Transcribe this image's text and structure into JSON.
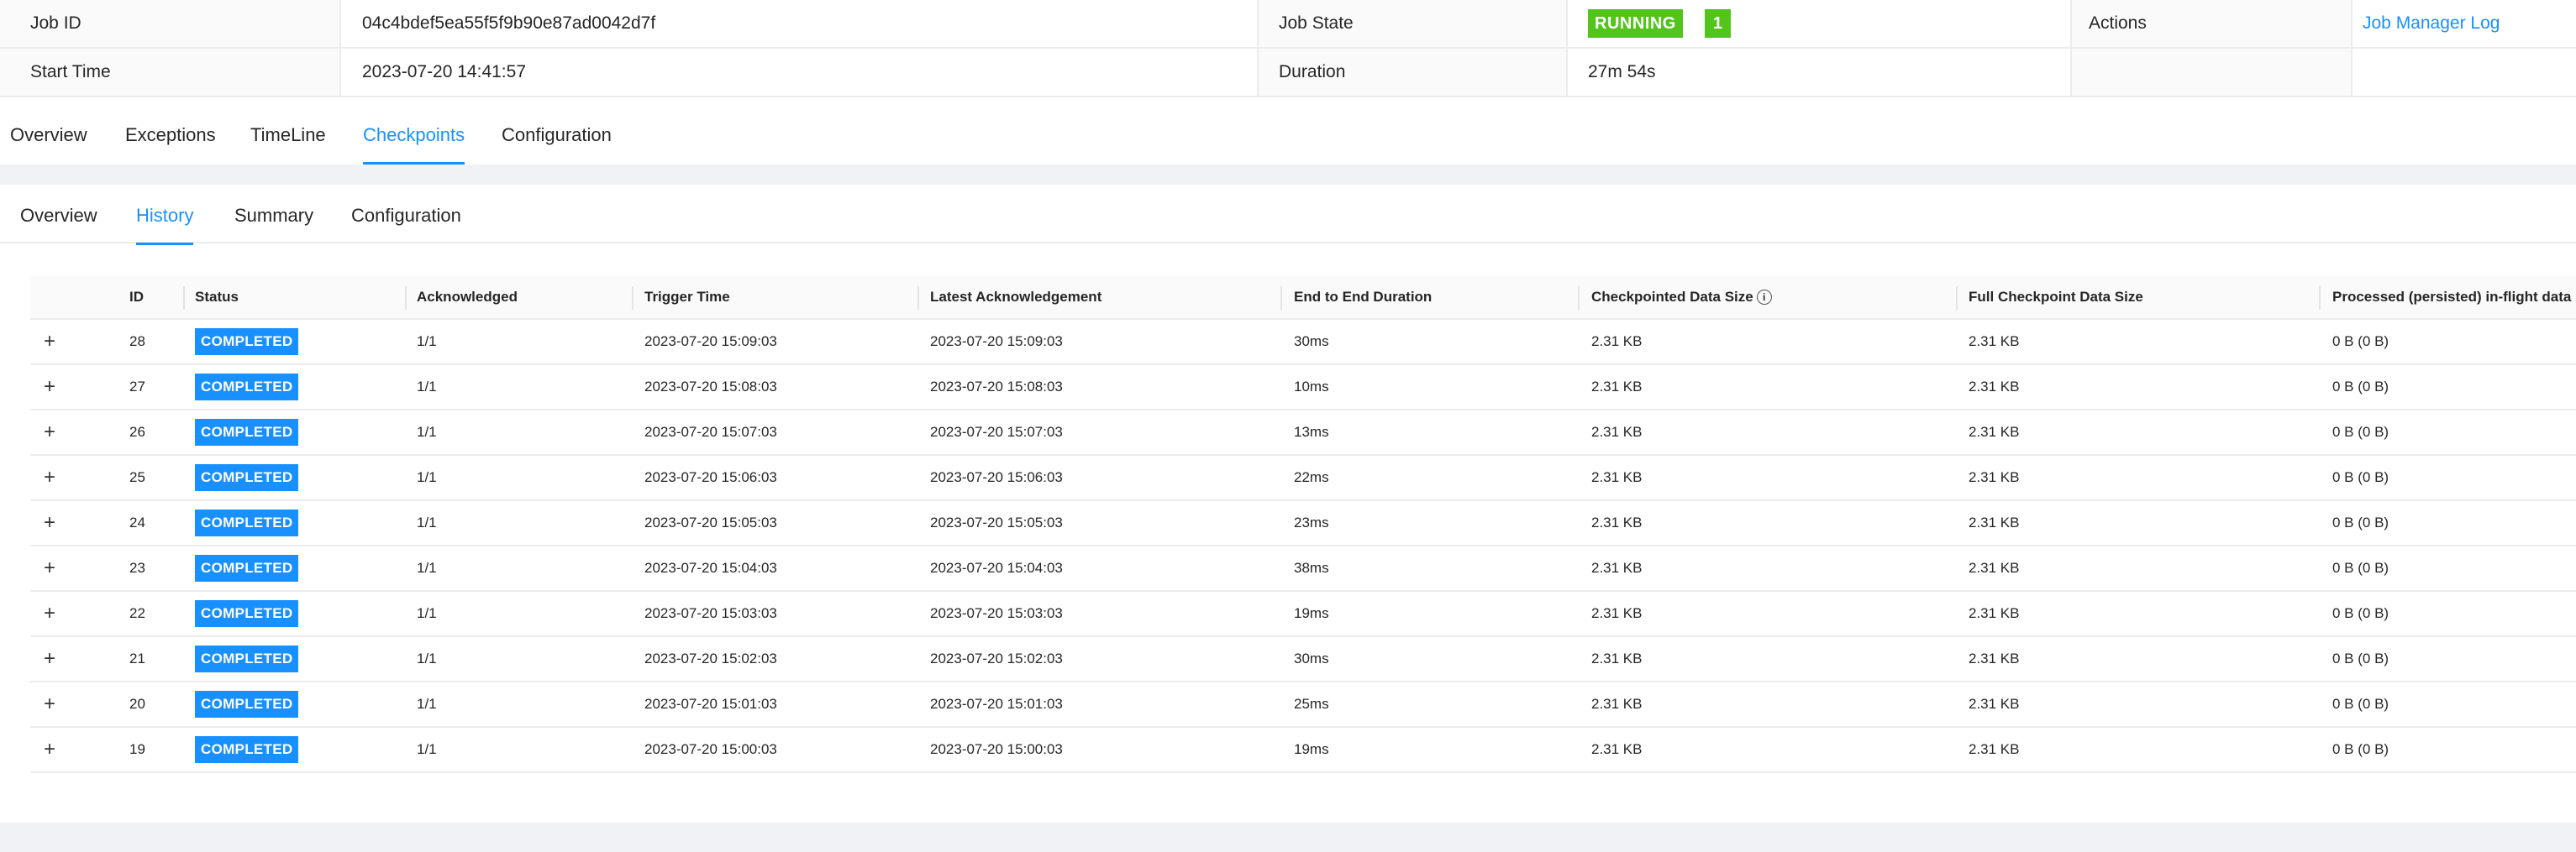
{
  "job": {
    "id_label": "Job ID",
    "id_value": "04c4bdef5ea55f5f9b90e87ad0042d7f",
    "state_label": "Job State",
    "state_value": "RUNNING",
    "state_count": "1",
    "actions_label": "Actions",
    "actions_link": "Job Manager Log",
    "start_label": "Start Time",
    "start_value": "2023-07-20 14:41:57",
    "duration_label": "Duration",
    "duration_value": "27m 54s"
  },
  "tabs": [
    "Overview",
    "Exceptions",
    "TimeLine",
    "Checkpoints",
    "Configuration"
  ],
  "subtabs": [
    "Overview",
    "History",
    "Summary",
    "Configuration"
  ],
  "table": {
    "headers": [
      "ID",
      "Status",
      "Acknowledged",
      "Trigger Time",
      "Latest Acknowledgement",
      "End to End Duration",
      "Checkpointed Data Size",
      "Full Checkpoint Data Size",
      "Processed (persisted) in-flight data"
    ],
    "expand_symbol": "+",
    "info_symbol": "i",
    "rows": [
      {
        "id": "28",
        "status": "COMPLETED",
        "ack": "1/1",
        "trigger": "2023-07-20 15:09:03",
        "latest": "2023-07-20 15:09:03",
        "duration": "30ms",
        "size": "2.31 KB",
        "full": "2.31 KB",
        "inflight": "0 B (0 B)"
      },
      {
        "id": "27",
        "status": "COMPLETED",
        "ack": "1/1",
        "trigger": "2023-07-20 15:08:03",
        "latest": "2023-07-20 15:08:03",
        "duration": "10ms",
        "size": "2.31 KB",
        "full": "2.31 KB",
        "inflight": "0 B (0 B)"
      },
      {
        "id": "26",
        "status": "COMPLETED",
        "ack": "1/1",
        "trigger": "2023-07-20 15:07:03",
        "latest": "2023-07-20 15:07:03",
        "duration": "13ms",
        "size": "2.31 KB",
        "full": "2.31 KB",
        "inflight": "0 B (0 B)"
      },
      {
        "id": "25",
        "status": "COMPLETED",
        "ack": "1/1",
        "trigger": "2023-07-20 15:06:03",
        "latest": "2023-07-20 15:06:03",
        "duration": "22ms",
        "size": "2.31 KB",
        "full": "2.31 KB",
        "inflight": "0 B (0 B)"
      },
      {
        "id": "24",
        "status": "COMPLETED",
        "ack": "1/1",
        "trigger": "2023-07-20 15:05:03",
        "latest": "2023-07-20 15:05:03",
        "duration": "23ms",
        "size": "2.31 KB",
        "full": "2.31 KB",
        "inflight": "0 B (0 B)"
      },
      {
        "id": "23",
        "status": "COMPLETED",
        "ack": "1/1",
        "trigger": "2023-07-20 15:04:03",
        "latest": "2023-07-20 15:04:03",
        "duration": "38ms",
        "size": "2.31 KB",
        "full": "2.31 KB",
        "inflight": "0 B (0 B)"
      },
      {
        "id": "22",
        "status": "COMPLETED",
        "ack": "1/1",
        "trigger": "2023-07-20 15:03:03",
        "latest": "2023-07-20 15:03:03",
        "duration": "19ms",
        "size": "2.31 KB",
        "full": "2.31 KB",
        "inflight": "0 B (0 B)"
      },
      {
        "id": "21",
        "status": "COMPLETED",
        "ack": "1/1",
        "trigger": "2023-07-20 15:02:03",
        "latest": "2023-07-20 15:02:03",
        "duration": "30ms",
        "size": "2.31 KB",
        "full": "2.31 KB",
        "inflight": "0 B (0 B)"
      },
      {
        "id": "20",
        "status": "COMPLETED",
        "ack": "1/1",
        "trigger": "2023-07-20 15:01:03",
        "latest": "2023-07-20 15:01:03",
        "duration": "25ms",
        "size": "2.31 KB",
        "full": "2.31 KB",
        "inflight": "0 B (0 B)"
      },
      {
        "id": "19",
        "status": "COMPLETED",
        "ack": "1/1",
        "trigger": "2023-07-20 15:00:03",
        "latest": "2023-07-20 15:00:03",
        "duration": "19ms",
        "size": "2.31 KB",
        "full": "2.31 KB",
        "inflight": "0 B (0 B)"
      }
    ]
  },
  "colors": {
    "accent": "#1890ff",
    "running": "#52c41a",
    "completed": "#1890ff"
  }
}
